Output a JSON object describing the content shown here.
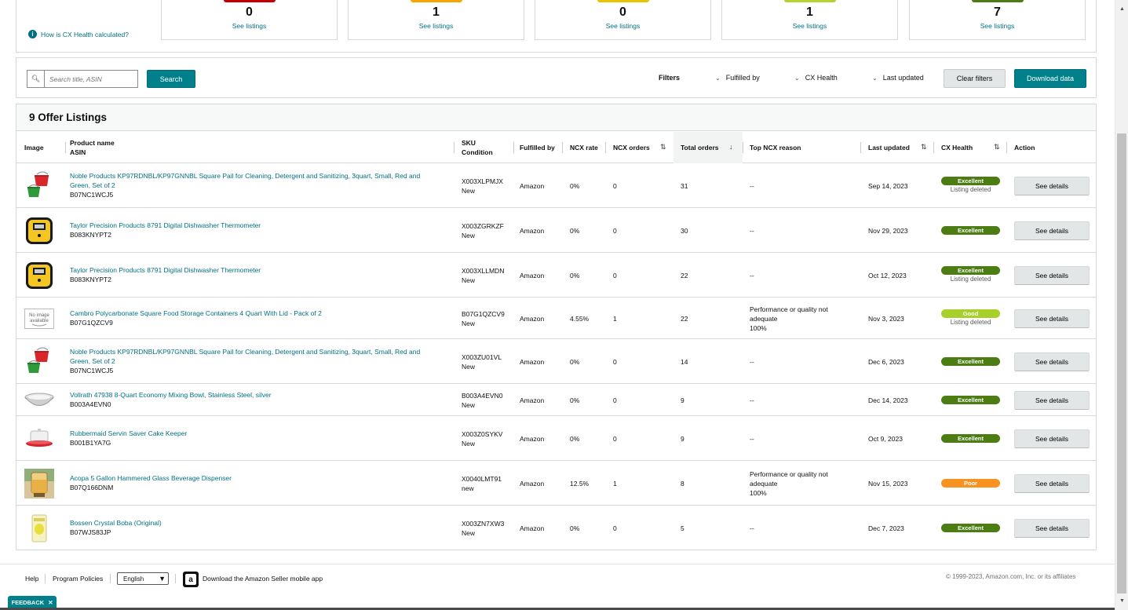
{
  "summary": {
    "help_link": "How is CX Health calculated?",
    "cards": [
      {
        "count": "0",
        "link": "See listings",
        "color": "#c40000"
      },
      {
        "count": "1",
        "link": "See listings",
        "color": "#f7a600"
      },
      {
        "count": "0",
        "link": "See listings",
        "color": "#e8c300"
      },
      {
        "count": "1",
        "link": "See listings",
        "color": "#b4d432"
      },
      {
        "count": "7",
        "link": "See listings",
        "color": "#4b7d12"
      }
    ]
  },
  "toolbar": {
    "search_placeholder": "Search title, ASIN",
    "search_button": "Search",
    "filters_label": "Filters",
    "fulfilled_by": "Fulfilled by",
    "cx_health": "CX Health",
    "last_updated": "Last updated",
    "clear_filters": "Clear filters",
    "download_data": "Download data"
  },
  "table": {
    "title": "9 Offer Listings",
    "headers": {
      "image": "Image",
      "product_name": "Product name",
      "asin": "ASIN",
      "sku": "SKU",
      "condition": "Condition",
      "fulfilled_by": "Fulfilled by",
      "ncx_rate": "NCX rate",
      "ncx_orders": "NCX orders",
      "total_orders": "Total orders",
      "top_ncx_reason": "Top NCX reason",
      "last_updated": "Last updated",
      "cx_health": "CX Health",
      "action": "Action"
    },
    "rows": [
      {
        "image": "pail-icon",
        "name_line1": "Noble Products KP97RDNBL/KP97GNNBL Square Pail for Cleaning, Detergent and Sanitizing, 3quart, Small, Red and",
        "name_line2": "Green, Set of 2",
        "asin": "B07NC1WCJ5",
        "sku": "X003XLPMJX",
        "condition": "New",
        "fulfilled": "Amazon",
        "ncx_rate": "0%",
        "ncx_orders": "0",
        "total_orders": "31",
        "reason1": "--",
        "reason2": "",
        "reason3": "",
        "updated": "Sep 14, 2023",
        "health": "Excellent",
        "health_color": "#4b7d12",
        "health_sub": "Listing deleted",
        "action": "See details"
      },
      {
        "image": "thermometer-icon",
        "name_line1": "Taylor Precision Products 8791 Digital Dishwasher Thermometer",
        "name_line2": "",
        "asin": "B083KNYPT2",
        "sku": "X003ZGRKZF",
        "condition": "New",
        "fulfilled": "Amazon",
        "ncx_rate": "0%",
        "ncx_orders": "0",
        "total_orders": "30",
        "reason1": "--",
        "reason2": "",
        "reason3": "",
        "updated": "Nov 29, 2023",
        "health": "Excellent",
        "health_color": "#4b7d12",
        "health_sub": "",
        "action": "See details"
      },
      {
        "image": "thermometer-icon",
        "name_line1": "Taylor Precision Products 8791 Digital Dishwasher Thermometer",
        "name_line2": "",
        "asin": "B083KNYPT2",
        "sku": "X003XLLMDN",
        "condition": "New",
        "fulfilled": "Amazon",
        "ncx_rate": "0%",
        "ncx_orders": "0",
        "total_orders": "22",
        "reason1": "--",
        "reason2": "",
        "reason3": "",
        "updated": "Oct 12, 2023",
        "health": "Excellent",
        "health_color": "#4b7d12",
        "health_sub": "Listing deleted",
        "action": "See details"
      },
      {
        "image": "no-image-available",
        "name_line1": "Cambro Polycarbonate Square Food Storage Containers 4 Quart With Lid - Pack of 2",
        "name_line2": "",
        "asin": "B07G1QZCV9",
        "sku": "B07G1QZCV9",
        "condition": "New",
        "fulfilled": "Amazon",
        "ncx_rate": "4.55%",
        "ncx_orders": "1",
        "total_orders": "22",
        "reason1": "Performance or quality not",
        "reason2": "adequate",
        "reason3": "100%",
        "updated": "Nov 3, 2023",
        "health": "Good",
        "health_color": "#a8d02b",
        "health_sub": "Listing deleted",
        "action": "See details"
      },
      {
        "image": "pail-icon",
        "name_line1": "Noble Products KP97RDNBL/KP97GNNBL Square Pail for Cleaning, Detergent and Sanitizing, 3quart, Small, Red and",
        "name_line2": "Green, Set of 2",
        "asin": "B07NC1WCJ5",
        "sku": "X003ZU01VL",
        "condition": "New",
        "fulfilled": "Amazon",
        "ncx_rate": "0%",
        "ncx_orders": "0",
        "total_orders": "14",
        "reason1": "--",
        "reason2": "",
        "reason3": "",
        "updated": "Dec 6, 2023",
        "health": "Excellent",
        "health_color": "#4b7d12",
        "health_sub": "",
        "action": "See details"
      },
      {
        "image": "bowl-icon",
        "name_line1": "Vollrath 47938 8-Quart Economy Mixing Bowl, Stainless Steel, silver",
        "name_line2": "",
        "asin": "B003A4EVN0",
        "sku": "B003A4EVN0",
        "condition": "New",
        "fulfilled": "Amazon",
        "ncx_rate": "0%",
        "ncx_orders": "0",
        "total_orders": "9",
        "reason1": "--",
        "reason2": "",
        "reason3": "",
        "updated": "Dec 14, 2023",
        "health": "Excellent",
        "health_color": "#4b7d12",
        "health_sub": "",
        "action": "See details"
      },
      {
        "image": "cake-keeper-icon",
        "name_line1": "Rubbermaid Servin Saver Cake Keeper",
        "name_line2": "",
        "asin": "B001B1YA7G",
        "sku": "X003Z0SYKV",
        "condition": "New",
        "fulfilled": "Amazon",
        "ncx_rate": "0%",
        "ncx_orders": "0",
        "total_orders": "9",
        "reason1": "--",
        "reason2": "",
        "reason3": "",
        "updated": "Oct 9, 2023",
        "health": "Excellent",
        "health_color": "#4b7d12",
        "health_sub": "",
        "action": "See details"
      },
      {
        "image": "dispenser-icon",
        "name_line1": "Acopa 5 Gallon Hammered Glass Beverage Dispenser",
        "name_line2": "",
        "asin": "B07Q166DNM",
        "sku": "X0040LMT91",
        "condition": "new",
        "fulfilled": "Amazon",
        "ncx_rate": "12.5%",
        "ncx_orders": "1",
        "total_orders": "8",
        "reason1": "Performance or quality not",
        "reason2": "adequate",
        "reason3": "100%",
        "updated": "Nov 15, 2023",
        "health": "Poor",
        "health_color": "#f7931e",
        "health_sub": "",
        "action": "See details"
      },
      {
        "image": "boba-bag-icon",
        "name_line1": "Bossen Crystal Boba (Original)",
        "name_line2": "",
        "asin": "B07WJS83JP",
        "sku": "X003ZN7XW3",
        "condition": "New",
        "fulfilled": "Amazon",
        "ncx_rate": "0%",
        "ncx_orders": "0",
        "total_orders": "5",
        "reason1": "--",
        "reason2": "",
        "reason3": "",
        "updated": "Dec 7, 2023",
        "health": "Excellent",
        "health_color": "#4b7d12",
        "health_sub": "",
        "action": "See details"
      }
    ]
  },
  "footer": {
    "help": "Help",
    "program_policies": "Program Policies",
    "language": "English",
    "app_text": "Download the Amazon Seller mobile app",
    "copyright": "© 1999-2023, Amazon.com, Inc. or its affiliates",
    "feedback": "FEEDBACK"
  }
}
